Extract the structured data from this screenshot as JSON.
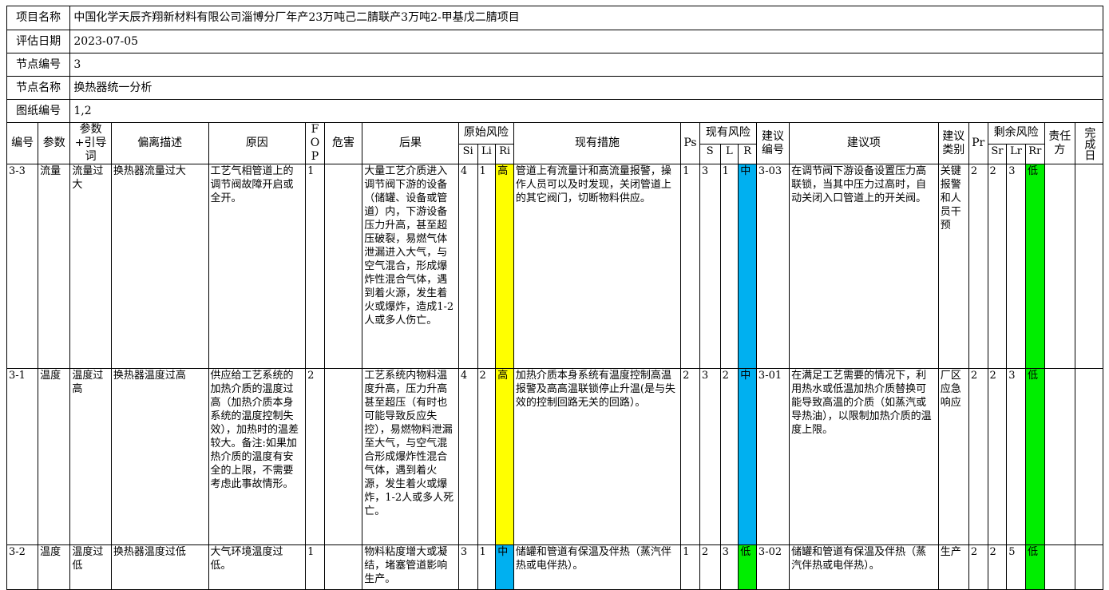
{
  "info": [
    {
      "label": "项目名称",
      "value": "中国化学天辰齐翔新材料有限公司淄博分厂年产23万吨己二腈联产3万吨2-甲基戊二腈项目"
    },
    {
      "label": "评估日期",
      "value": "2023-07-05"
    },
    {
      "label": "节点编号",
      "value": "3"
    },
    {
      "label": "节点名称",
      "value": "换热器统一分析"
    },
    {
      "label": "图纸编号",
      "value": "1,2"
    }
  ],
  "headers": {
    "no": "编号",
    "param": "参数",
    "guide": "参数+引导词",
    "deviation": "偏离描述",
    "cause": "原因",
    "fop": "FOP",
    "hazard": "危害",
    "consequence": "后果",
    "orig_risk": "原始风险",
    "si": "Si",
    "li": "Li",
    "ri": "Ri",
    "measures": "现有措施",
    "ps": "Ps",
    "cur_risk": "现有风险",
    "s": "S",
    "l": "L",
    "r": "R",
    "rec_no": "建议编号",
    "rec": "建议项",
    "rec_type": "建议类别",
    "pr": "Pr",
    "res_risk": "剩余风险",
    "sr": "Sr",
    "lr": "Lr",
    "rr": "Rr",
    "owner": "责任方",
    "done": "完成日"
  },
  "rows": [
    {
      "no": "3-3",
      "param": "流量",
      "guide": "流量过大",
      "deviation": "换热器流量过大",
      "cause": "工艺气相管道上的调节阀故障开启或全开。",
      "fop": "1",
      "hazard": "",
      "consequence": "大量工艺介质进入调节阀下游的设备（储罐、设备或管道）内，下游设备压力升高，甚至超压破裂，易燃气体泄漏进入大气，与空气混合，形成爆炸性混合气体，遇到着火源，发生着火或爆炸，造成1-2人或多人伤亡。",
      "si": "4",
      "li": "1",
      "ri": "高",
      "ri_color": "#ffff00",
      "measures": "管道上有流量计和高流量报警，操作人员可以及时发现，关闭管道上的其它阀门，切断物料供应。",
      "ps": "1",
      "s": "3",
      "l": "1",
      "r": "中",
      "r_color": "#00b0f0",
      "rec_no": "3-03",
      "rec": "在调节阀下游设备设置压力高联锁，当其中压力过高时，自动关闭入口管道上的开关阀。",
      "rec_type": "关键报警和人员干预",
      "pr": "2",
      "sr": "2",
      "lr": "3",
      "rr": "低",
      "rr_color": "#00ee00",
      "owner": "",
      "done": ""
    },
    {
      "no": "3-1",
      "param": "温度",
      "guide": "温度过高",
      "deviation": "换热器温度过高",
      "cause": "供应给工艺系统的加热介质的温度过高（加热介质本身系统的温度控制失效），加热时的温差较大。备注:如果加热介质的温度有安全的上限，不需要考虑此事故情形。",
      "fop": "2",
      "hazard": "",
      "consequence": "工艺系统内物料温度升高，压力升高甚至超压（有时也可能导致反应失控），易燃物料泄漏至大气，与空气混合形成爆炸性混合气体，遇到着火源，发生着火或爆炸，1-2人或多人死亡。",
      "si": "4",
      "li": "2",
      "ri": "高",
      "ri_color": "#ffff00",
      "measures": "加热介质本身系统有温度控制高温报警及高高温联锁停止升温(是与失效的控制回路无关的回路）。",
      "ps": "2",
      "s": "3",
      "l": "2",
      "r": "中",
      "r_color": "#00b0f0",
      "rec_no": "3-01",
      "rec": "在满足工艺需要的情况下，利用热水或低温加热介质替换可能导致高温的介质（如蒸汽或导热油），以限制加热介质的温度上限。",
      "rec_type": "厂区应急响应",
      "pr": "2",
      "sr": "2",
      "lr": "3",
      "rr": "低",
      "rr_color": "#00ee00",
      "owner": "",
      "done": ""
    },
    {
      "no": "3-2",
      "param": "温度",
      "guide": "温度过低",
      "deviation": "换热器温度过低",
      "cause": "大气环境温度过低。",
      "fop": "1",
      "hazard": "",
      "consequence": "物料粘度增大或凝结，堵塞管道影响生产。",
      "si": "3",
      "li": "1",
      "ri": "中",
      "ri_color": "#00b0f0",
      "measures": "储罐和管道有保温及伴热（蒸汽伴热或电伴热）。",
      "ps": "1",
      "s": "2",
      "l": "3",
      "r": "低",
      "r_color": "#00ee00",
      "rec_no": "3-02",
      "rec": "储罐和管道有保温及伴热（蒸汽伴热或电伴热）。",
      "rec_type": "生产",
      "pr": "2",
      "sr": "2",
      "lr": "5",
      "rr": "低",
      "rr_color": "#00ee00",
      "owner": "",
      "done": ""
    }
  ]
}
